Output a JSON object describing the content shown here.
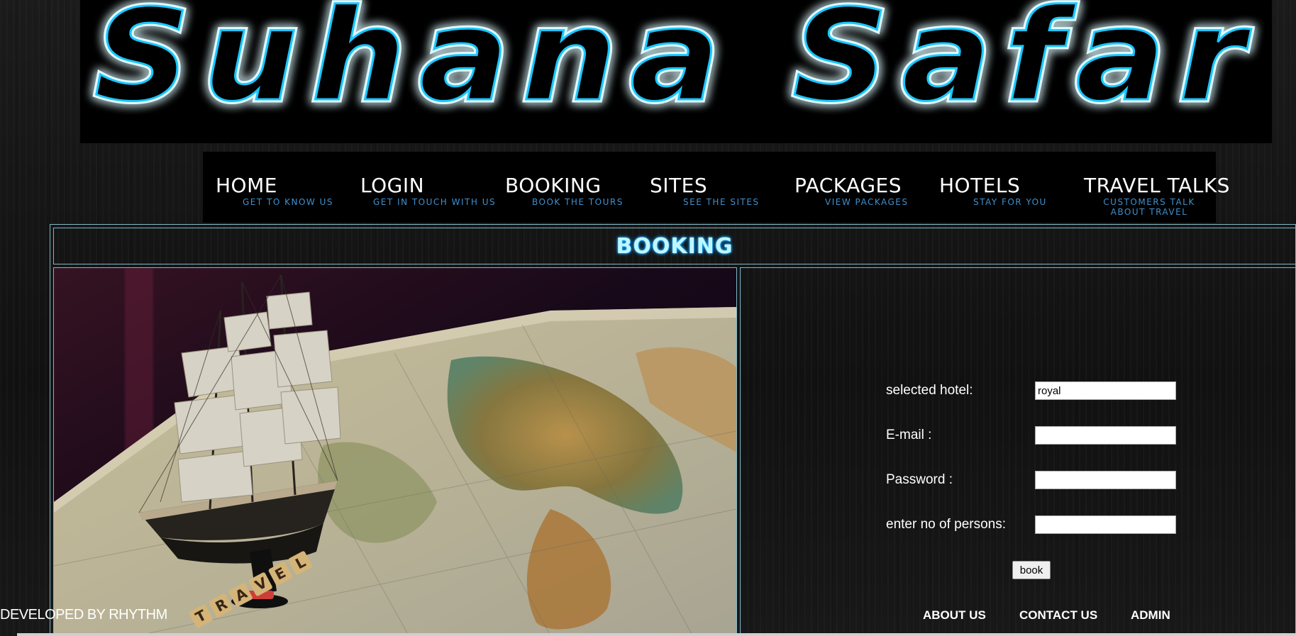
{
  "banner": {
    "logo_text": "Suhana Safar"
  },
  "nav": {
    "items": [
      {
        "title": "HOME",
        "subtitle": "GET TO KNOW US"
      },
      {
        "title": "LOGIN",
        "subtitle": "GET IN TOUCH WITH US"
      },
      {
        "title": "BOOKING",
        "subtitle": "BOOK THE TOURS"
      },
      {
        "title": "SITES",
        "subtitle": "SEE THE SITES"
      },
      {
        "title": "PACKAGES",
        "subtitle": "VIEW PACKAGES"
      },
      {
        "title": "HOTELS",
        "subtitle": "STAY FOR YOU"
      },
      {
        "title": "TRAVEL TALKS",
        "subtitle": "CUSTOMERS TALK ABOUT TRAVEL"
      }
    ]
  },
  "page": {
    "heading": "BOOKING"
  },
  "form": {
    "hotel_label": "selected hotel:",
    "hotel_value": "royal",
    "email_label": "E-mail :",
    "email_value": "",
    "password_label": "Password :",
    "password_value": "",
    "persons_label": "enter no of persons:",
    "persons_value": "",
    "submit_label": "book"
  },
  "footer": {
    "links": [
      "ABOUT US",
      "CONTACT US",
      "ADMIN"
    ],
    "developer_credit": "DEVELOPED BY RHYTHM"
  },
  "photo": {
    "scrabble_tiles": "TRAVEL"
  },
  "colors": {
    "accent": "#3e90cf",
    "neon": "#00c8ff",
    "frame": "#7fb6c8"
  }
}
